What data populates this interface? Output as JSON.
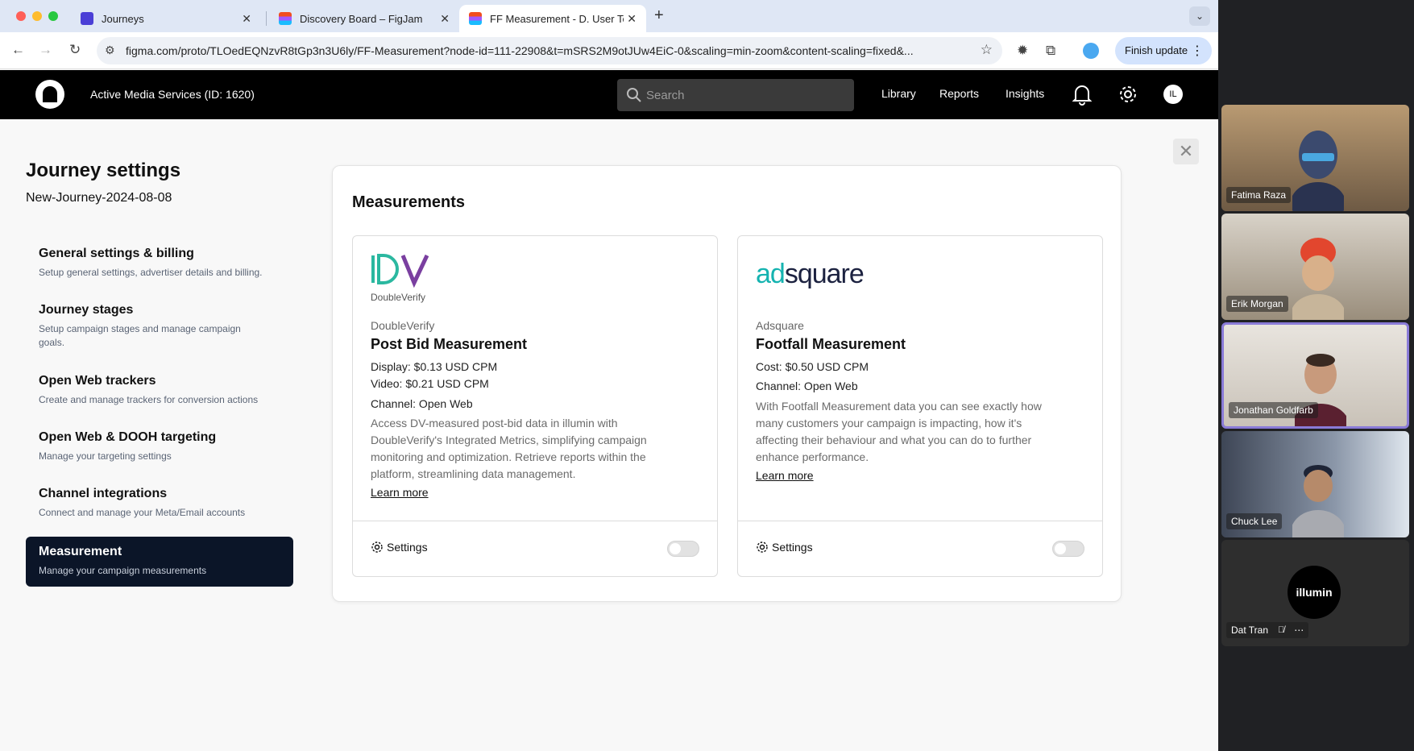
{
  "browser": {
    "tabs": [
      {
        "title": "Journeys",
        "favicon_color": "#4b3fd6"
      },
      {
        "title": "Discovery Board – FigJam",
        "favicon_color": "#f24e1e"
      },
      {
        "title": "FF Measurement - D. User Te",
        "favicon_color": "#a259ff"
      }
    ],
    "url": "figma.com/proto/TLOedEQNzvR8tGp3n3U6ly/FF-Measurement?node-id=111-22908&t=mSRS2M9otJUw4EiC-0&scaling=min-zoom&content-scaling=fixed&...",
    "finish_update_label": "Finish update"
  },
  "header": {
    "account": "Active Media Services (ID: 1620)",
    "search_placeholder": "Search",
    "nav": [
      "Library",
      "Reports",
      "Insights"
    ],
    "avatar_initials": "IL"
  },
  "sidebar": {
    "title": "Journey settings",
    "journey_name": "New-Journey-2024-08-08",
    "items": [
      {
        "title": "General settings & billing",
        "desc": "Setup general settings, advertiser details and billing.",
        "active": false
      },
      {
        "title": "Journey stages",
        "desc": "Setup campaign stages and manage campaign goals.",
        "active": false
      },
      {
        "title": "Open Web trackers",
        "desc": "Create and manage trackers for conversion actions",
        "active": false
      },
      {
        "title": "Open Web & DOOH targeting",
        "desc": "Manage your targeting settings",
        "active": false
      },
      {
        "title": "Channel integrations",
        "desc": "Connect and manage your Meta/Email accounts",
        "active": false
      },
      {
        "title": "Measurement",
        "desc": "Manage your campaign measurements",
        "active": true
      }
    ]
  },
  "measurements": {
    "title": "Measurements",
    "cards": [
      {
        "logo_text": "DoubleVerify",
        "vendor": "DoubleVerify",
        "product": "Post Bid Measurement",
        "lines": [
          "Display: $0.13 USD CPM",
          "Video: $0.21 USD CPM",
          "Channel: Open Web"
        ],
        "description": "Access DV-measured post-bid data in illumin with DoubleVerify's Integrated Metrics, simplifying campaign monitoring and optimization. Retrieve reports within the platform, streamlining data management.",
        "learn_more": "Learn more",
        "settings_label": "Settings",
        "enabled": false
      },
      {
        "logo_text": "adsquare",
        "vendor": "Adsquare",
        "product": "Footfall Measurement",
        "lines": [
          "Cost: $0.50 USD CPM",
          "Channel: Open Web"
        ],
        "description": "With Footfall Measurement data you can see exactly how many customers your campaign is impacting, how it's affecting their behaviour and what you can do to further enhance performance.",
        "learn_more": "Learn more",
        "settings_label": "Settings",
        "enabled": false
      }
    ]
  },
  "call": {
    "participants": [
      {
        "name": "Fatima Raza"
      },
      {
        "name": "Erik Morgan"
      },
      {
        "name": "Jonathan Goldfarb",
        "speaking": true
      },
      {
        "name": "Chuck Lee"
      },
      {
        "name": "Dat Tran",
        "avatar_text": "illumin",
        "muted": true
      }
    ]
  }
}
